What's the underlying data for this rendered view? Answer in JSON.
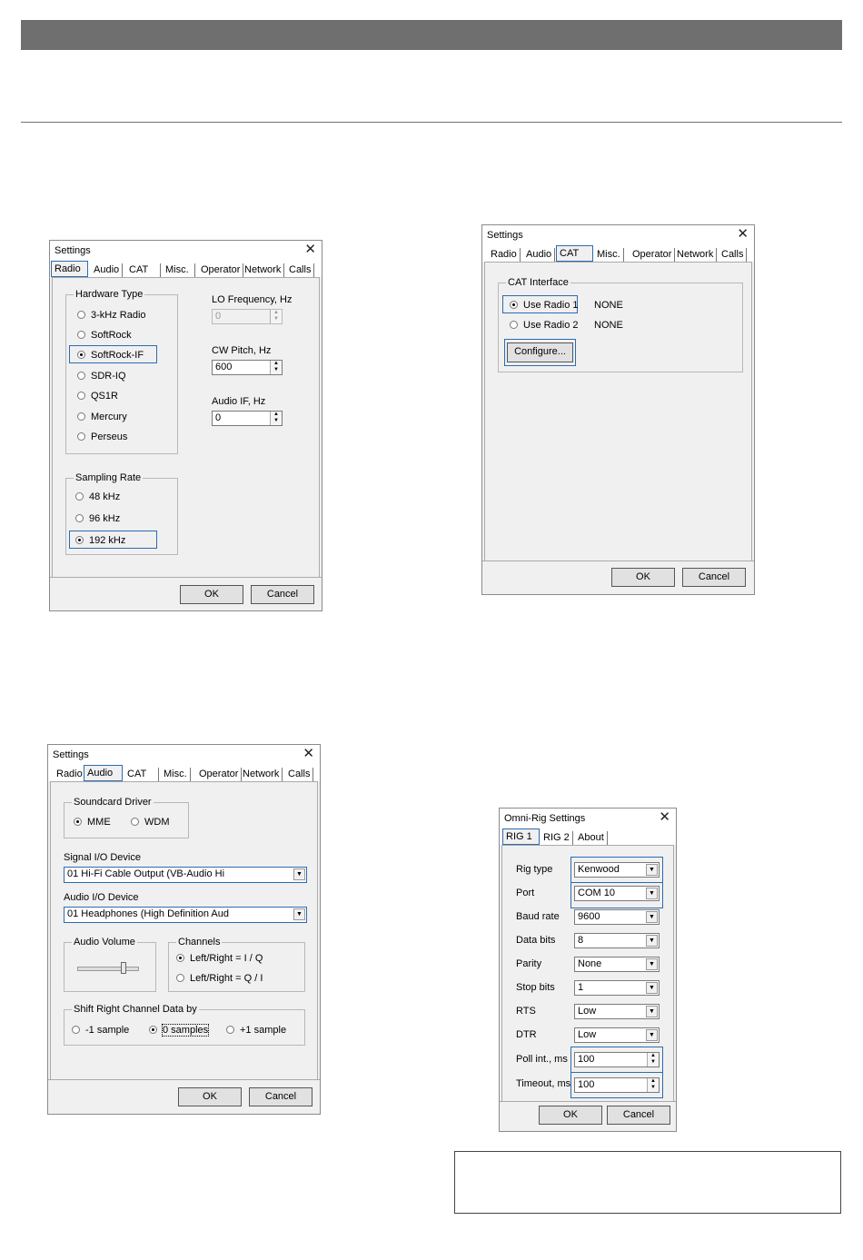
{
  "radio_window": {
    "title": "Settings",
    "close_glyph": "✕",
    "tabs": [
      "Radio",
      "Audio",
      "CAT",
      "Misc.",
      "Operator",
      "Network",
      "Calls"
    ],
    "hardware_type_label": "Hardware Type",
    "hardware_types": [
      "3-kHz Radio",
      "SoftRock",
      "SoftRock-IF",
      "SDR-IQ",
      "QS1R",
      "Mercury",
      "Perseus"
    ],
    "sampling_rate_label": "Sampling Rate",
    "sampling_rates": [
      "48 kHz",
      "96 kHz",
      "192 kHz"
    ],
    "lo_freq_label": "LO Frequency, Hz",
    "lo_freq_value": "0",
    "cw_pitch_label": "CW Pitch, Hz",
    "cw_pitch_value": "600",
    "audio_if_label": "Audio IF, Hz",
    "audio_if_value": "0",
    "ok": "OK",
    "cancel": "Cancel"
  },
  "cat_window": {
    "title": "Settings",
    "close_glyph": "✕",
    "tabs": [
      "Radio",
      "Audio",
      "CAT",
      "Misc.",
      "Operator",
      "Network",
      "Calls"
    ],
    "group_label": "CAT Interface",
    "use_radio_1": "Use Radio 1",
    "use_radio_2": "Use Radio 2",
    "radio_1_value": "NONE",
    "radio_2_value": "NONE",
    "configure": "Configure...",
    "ok": "OK",
    "cancel": "Cancel"
  },
  "audio_window": {
    "title": "Settings",
    "close_glyph": "✕",
    "tabs": [
      "Radio",
      "Audio",
      "CAT",
      "Misc.",
      "Operator",
      "Network",
      "Calls"
    ],
    "soundcard_label": "Soundcard Driver",
    "mme": "MME",
    "wdm": "WDM",
    "signal_io_label": "Signal I/O Device",
    "signal_io_value": "01  Hi-Fi Cable Output (VB-Audio Hi",
    "audio_io_label": "Audio I/O Device",
    "audio_io_value": "01  Headphones (High Definition Aud",
    "volume_label": "Audio Volume",
    "channels_label": "Channels",
    "channel_opt1": "Left/Right = I / Q",
    "channel_opt2": "Left/Right = Q / I",
    "shift_label": "Shift Right Channel Data by",
    "shift_opt1": "-1 sample",
    "shift_opt2": "0 samples",
    "shift_opt3": "+1 sample",
    "ok": "OK",
    "cancel": "Cancel"
  },
  "omnirig_window": {
    "title": "Omni-Rig Settings",
    "close_glyph": "✕",
    "tabs": [
      "RIG 1",
      "RIG 2",
      "About"
    ],
    "rows": [
      {
        "label": "Rig type",
        "value": "Kenwood"
      },
      {
        "label": "Port",
        "value": "COM 10"
      },
      {
        "label": "Baud rate",
        "value": "9600"
      },
      {
        "label": "Data bits",
        "value": "8"
      },
      {
        "label": "Parity",
        "value": "None"
      },
      {
        "label": "Stop bits",
        "value": "1"
      },
      {
        "label": "RTS",
        "value": "Low"
      },
      {
        "label": "DTR",
        "value": "Low"
      },
      {
        "label": "Poll int., ms",
        "value": "100"
      },
      {
        "label": "Timeout, ms",
        "value": "100"
      }
    ],
    "ok": "OK",
    "cancel": "Cancel"
  }
}
